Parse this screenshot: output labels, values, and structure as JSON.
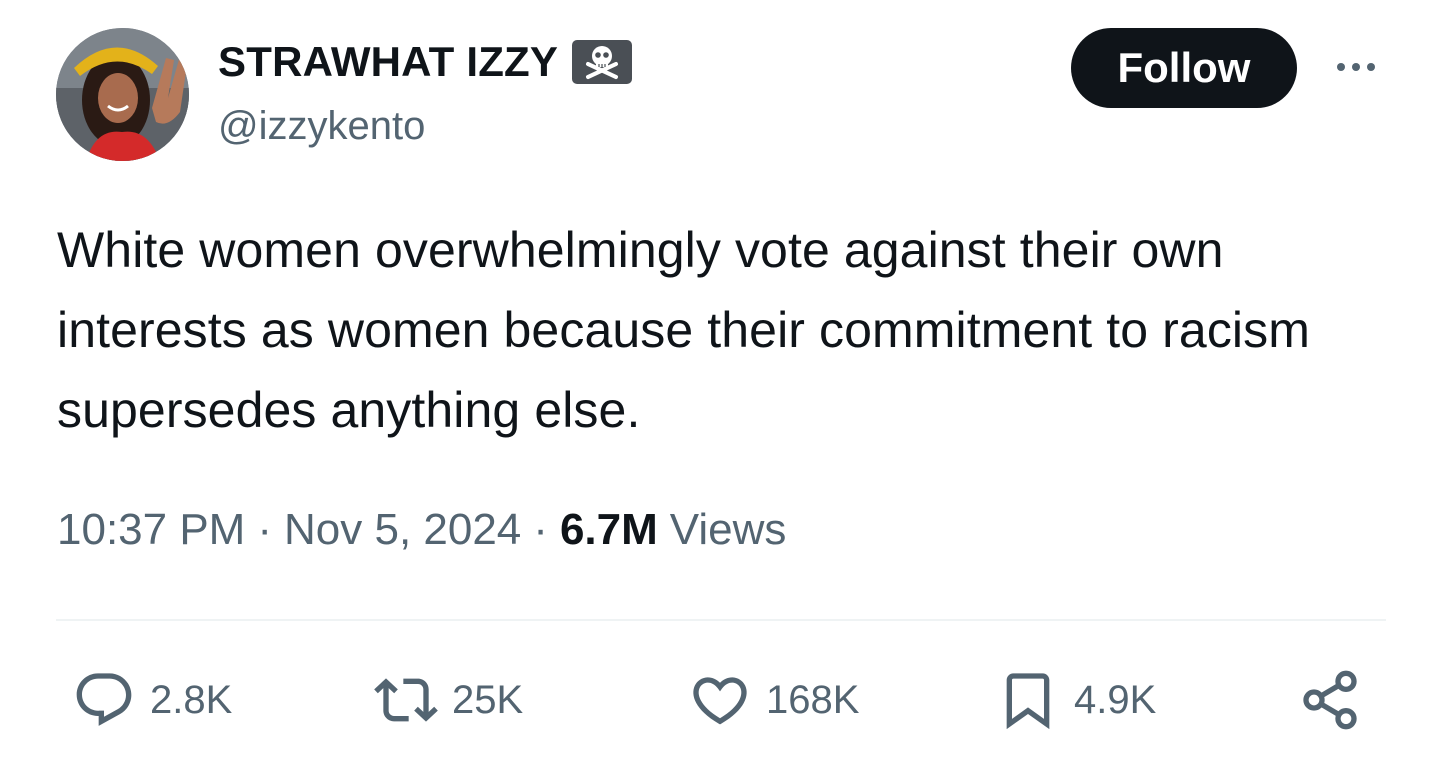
{
  "author": {
    "display_name": "STRAWHAT IZZY",
    "handle": "@izzykento",
    "badge_icon": "skull-crossbones-icon"
  },
  "follow_button": {
    "label": "Follow"
  },
  "tweet": {
    "text": "White women overwhelmingly vote against their own interests as women because their commitment to racism supersedes anything else.",
    "time": "10:37 PM",
    "date": "Nov 5, 2024",
    "separator": "·",
    "views_count": "6.7M",
    "views_label": "Views"
  },
  "actions": {
    "replies": "2.8K",
    "reposts": "25K",
    "likes": "168K",
    "bookmarks": "4.9K"
  },
  "colors": {
    "text_primary": "#0f1419",
    "text_secondary": "#536471",
    "follow_bg": "#0f1419",
    "divider": "#eff3f4"
  }
}
